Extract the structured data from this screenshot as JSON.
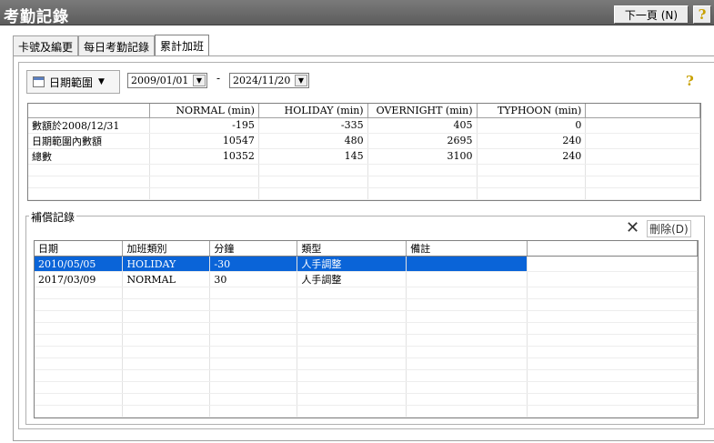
{
  "window": {
    "title": "考勤記錄",
    "next_page_label": "下一頁 (N)",
    "help_glyph": "?"
  },
  "tabs": [
    {
      "label": "卡號及編更",
      "active": false
    },
    {
      "label": "每日考勤記錄",
      "active": false
    },
    {
      "label": "累計加班",
      "active": true
    }
  ],
  "filter": {
    "range_button_label": "日期範圍",
    "date_from": "2009/01/01",
    "date_to": "2024/11/20",
    "separator": "-"
  },
  "summary_table": {
    "columns": [
      "",
      "NORMAL (min)",
      "HOLIDAY (min)",
      "OVERNIGHT (min)",
      "TYPHOON (min)"
    ],
    "rows": [
      {
        "label": "數額於2008/12/31",
        "normal": "-195",
        "holiday": "-335",
        "overnight": "405",
        "typhoon": "0"
      },
      {
        "label": "日期範圍內數額",
        "normal": "10547",
        "holiday": "480",
        "overnight": "2695",
        "typhoon": "240"
      },
      {
        "label": "總數",
        "normal": "10352",
        "holiday": "145",
        "overnight": "3100",
        "typhoon": "240"
      }
    ]
  },
  "comp_section": {
    "label": "補償記錄",
    "delete_label": "刪除(D)",
    "columns": [
      "日期",
      "加班類別",
      "分鐘",
      "類型",
      "備註"
    ],
    "rows": [
      {
        "date": "2010/05/05",
        "category": "HOLIDAY",
        "minutes": "-30",
        "type": "人手調整",
        "note": "",
        "selected": true
      },
      {
        "date": "2017/03/09",
        "category": "NORMAL",
        "minutes": "30",
        "type": "人手調整",
        "note": "",
        "selected": false
      }
    ]
  }
}
